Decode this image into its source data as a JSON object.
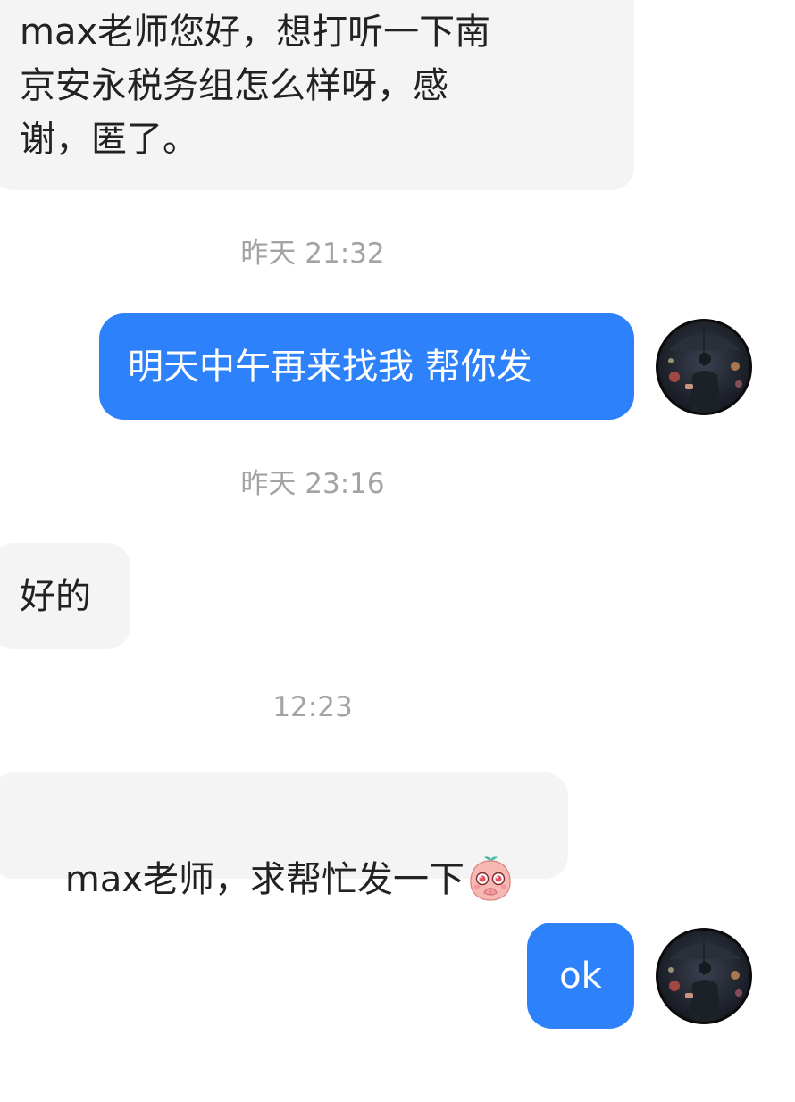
{
  "messages": [
    {
      "type": "incoming",
      "text": "max老师您好，想打听一下南\n京安永税务组怎么样呀，感\n谢，匿了。"
    },
    {
      "type": "timestamp",
      "text": "昨天 21:32"
    },
    {
      "type": "outgoing",
      "text": "明天中午再来找我 帮你发"
    },
    {
      "type": "timestamp",
      "text": "昨天 23:16"
    },
    {
      "type": "incoming",
      "text": "好的"
    },
    {
      "type": "timestamp",
      "text": "12:23"
    },
    {
      "type": "incoming",
      "text": "max老师，求帮忙发一下",
      "emoji": "pleading-peach-emoji"
    },
    {
      "type": "outgoing",
      "text": "ok"
    }
  ],
  "colors": {
    "incoming_bubble": "#f4f4f4",
    "outgoing_bubble": "#2d82fb",
    "timestamp_text": "#a3a3a3"
  },
  "icons": {
    "avatar": "man-with-umbrella-avatar",
    "emoji": "pleading-peach-emoji"
  }
}
